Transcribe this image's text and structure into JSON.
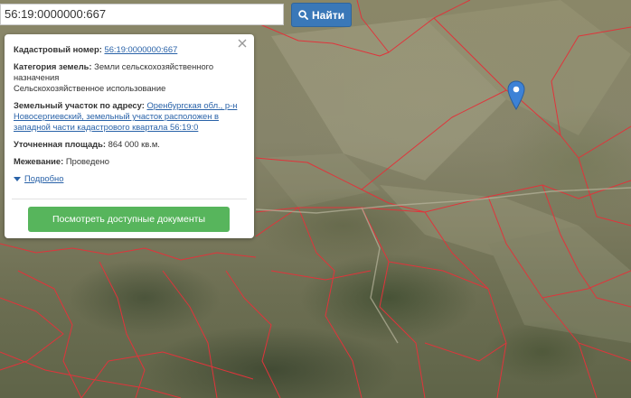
{
  "search": {
    "value": "56:19:0000000:667",
    "button_label": "Найти"
  },
  "popup": {
    "cadastral_label": "Кадастровый номер:",
    "cadastral_value": "56:19:0000000:667",
    "category_label": "Категория земель:",
    "category_value": "Земли сельскохозяйственного назначения",
    "usage_value": "Сельскохозяйственное использование",
    "address_label": "Земельный участок по адресу:",
    "address_value": "Оренбургская обл., р-н Новосергиевский, земельный участок расположен в западной части кадастрового квартала 56:19:0",
    "area_label": "Уточненная площадь:",
    "area_value": "864 000 кв.м.",
    "survey_label": "Межевание:",
    "survey_value": "Проведено",
    "details_label": "Подробно",
    "docs_button": "Посмотреть доступные документы"
  },
  "colors": {
    "boundary": "#e0343b",
    "button_blue": "#3a78b8",
    "button_green": "#57b55c",
    "link": "#2962a8",
    "marker": "#3d82d6"
  },
  "icons": {
    "search_button": "search-icon",
    "close": "close-icon",
    "marker": "map-marker-icon",
    "details": "caret-down-icon"
  }
}
